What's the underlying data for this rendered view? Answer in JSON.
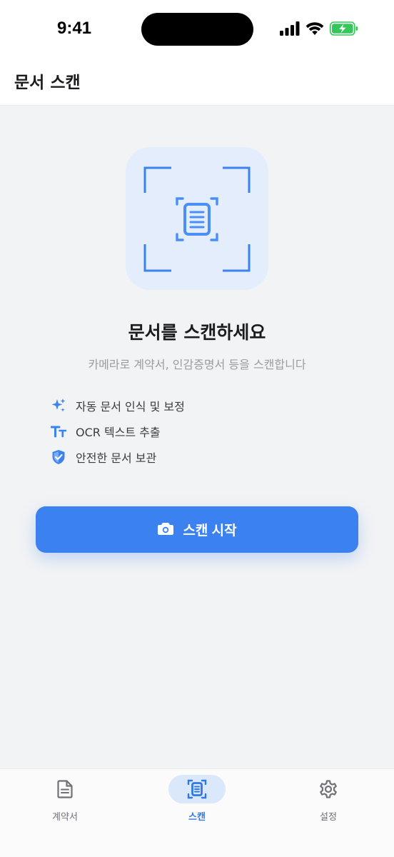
{
  "status_bar": {
    "time": "9:41",
    "icons": [
      "cellular-signal-icon",
      "wifi-icon",
      "battery-charging-icon"
    ]
  },
  "header": {
    "title": "문서 스캔"
  },
  "main": {
    "illustration_icon": "document-scan-icon",
    "heading": "문서를 스캔하세요",
    "subheading": "카메라로 계약서, 인감증명서 등을 스캔합니다",
    "features": [
      {
        "icon": "sparkles-icon",
        "label": "자동 문서 인식 및 보정"
      },
      {
        "icon": "text-size-icon",
        "label": "OCR 텍스트 추출"
      },
      {
        "icon": "shield-check-icon",
        "label": "안전한 문서 보관"
      }
    ],
    "scan_button": {
      "icon": "camera-icon",
      "label": "스캔 시작"
    }
  },
  "tab_bar": {
    "tabs": [
      {
        "icon": "document-icon",
        "label": "계약서",
        "active": false
      },
      {
        "icon": "scan-icon",
        "label": "스캔",
        "active": true
      },
      {
        "icon": "gear-icon",
        "label": "설정",
        "active": false
      }
    ]
  },
  "colors": {
    "accent": "#3b82f0",
    "accent_soft": "#e3edfb",
    "background": "#f2f3f5",
    "battery_green": "#34c759"
  }
}
